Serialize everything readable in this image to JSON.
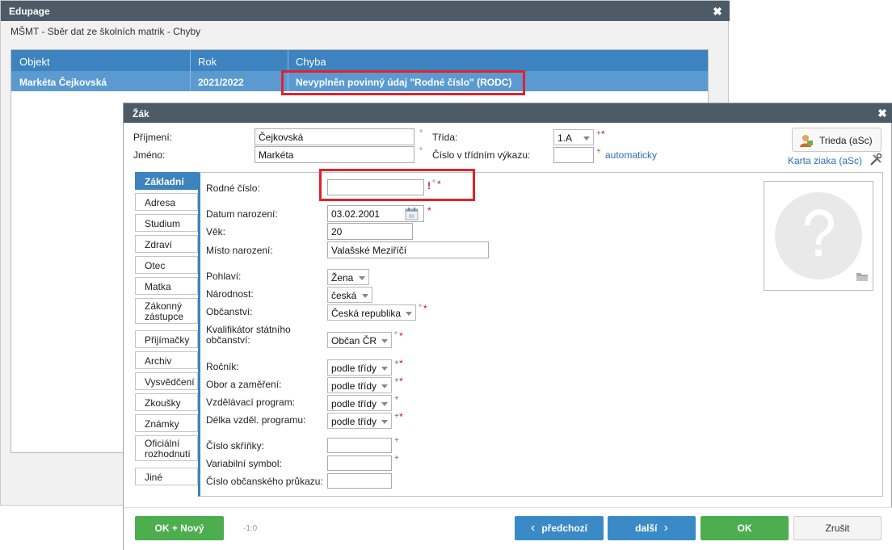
{
  "back_window": {
    "title": "Edupage",
    "close_glyph": "✖",
    "subtitle": "MŠMT - Sběr dat ze školních matrik - Chyby",
    "grid": {
      "columns": [
        "Objekt",
        "Rok",
        "Chyba"
      ],
      "rows": [
        {
          "objekt": "Markéta Čejkovská",
          "rok": "2021/2022",
          "chyba": "Nevyplněn povinný údaj \"Rodné číslo\" (RODC)"
        }
      ]
    }
  },
  "dialog": {
    "title": "Žák",
    "close_glyph": "✖",
    "header": {
      "prijmeni_label": "Příjmení:",
      "prijmeni_value": "Čejkovská",
      "jmeno_label": "Jméno:",
      "jmeno_value": "Markéta",
      "degree_mark": "°",
      "trida_label": "Třída:",
      "trida_value": "1.A",
      "cislo_label": "Číslo v třídním výkazu:",
      "cislo_value": "",
      "cislo_mark": "+",
      "trida_mark_plus": "+",
      "trida_mark_star": "*",
      "automaticky": "automaticky",
      "trieda_button": "Trieda (aSc)",
      "karta_link": "Karta ziaka (aSc)"
    },
    "tabs": [
      {
        "label": "Základní",
        "active": true
      },
      {
        "label": "Adresa"
      },
      {
        "label": "Studium"
      },
      {
        "label": "Zdraví"
      },
      {
        "label": "Otec"
      },
      {
        "label": "Matka"
      },
      {
        "label": "Zákonný zástupce"
      },
      {
        "label": "Přijímačky"
      },
      {
        "label": "Archiv"
      },
      {
        "label": "Vysvědčení"
      },
      {
        "label": "Zkoušky"
      },
      {
        "label": "Známky"
      },
      {
        "label": "Oficiální rozhodnutí"
      },
      {
        "label": "Jiné"
      }
    ],
    "form": {
      "rodne_cislo_label": "Rodné číslo:",
      "rodne_cislo_value": "",
      "rodne_marks_excl": "!",
      "rodne_marks_o": "°",
      "rodne_marks_star": "*",
      "datum_label": "Datum narození:",
      "datum_value": "03.02.2001",
      "datum_mark": "*",
      "vek_label": "Věk:",
      "vek_value": "20",
      "misto_label": "Místo narození:",
      "misto_value": "Valašské Meziříčí",
      "pohlavi_label": "Pohlaví:",
      "pohlavi_value": "Žena",
      "narodnost_label": "Národnost:",
      "narodnost_value": "česká",
      "obcanstvi_label": "Občanství:",
      "obcanstvi_value": "Česká republika",
      "obcanstvi_mark_o": "°",
      "obcanstvi_mark_star": "*",
      "kvalifikator_label_1": "Kvalifikátor státního",
      "kvalifikator_label_2": "občanství:",
      "kvalifikator_value": "Občan ČR",
      "kval_mark_o": "°",
      "kval_mark_star": "*",
      "rocnik_label": "Ročník:",
      "rocnik_value": "podle třídy",
      "obor_label": "Obor a zaměření:",
      "obor_value": "podle třídy",
      "vzdel_label": "Vzdělávací program:",
      "vzdel_value": "podle třídy",
      "delka_label": "Délka vzděl. programu:",
      "delka_value": "podle třídy",
      "plus": "+",
      "star": "*",
      "skrinka_label": "Číslo skříňky:",
      "skrinka_value": "",
      "variabilni_label": "Variabilní symbol:",
      "variabilni_value": "",
      "prukaz_label": "Číslo občanského průkazu:",
      "prukaz_value": ""
    },
    "footer": {
      "ok_novy": "OK + Nový",
      "counter": "-1:0",
      "predchozi": "předchozí",
      "dalsi": "další",
      "ok": "OK",
      "zrusit": "Zrušit"
    }
  },
  "colors": {
    "title_bar": "#4c5b66",
    "grid_header": "#3c83bf",
    "grid_row": "#5b9ad1",
    "highlight": "#e3212a",
    "ok_green": "#4cae4f",
    "nav_blue": "#3a8ac8"
  }
}
